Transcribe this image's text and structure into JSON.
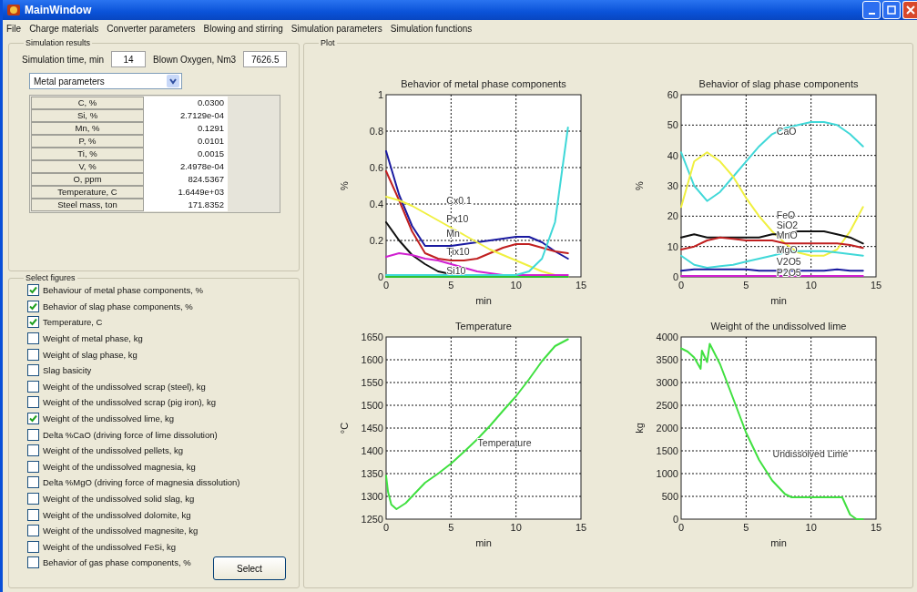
{
  "window": {
    "title": "MainWindow"
  },
  "menu": [
    "File",
    "Charge materials",
    "Converter parameters",
    "Blowing and stirring",
    "Simulation parameters",
    "Simulation functions"
  ],
  "simulation_results": {
    "title": "Simulation results",
    "time_label": "Simulation time, min",
    "time_value": "14",
    "oxygen_label": "Blown Oxygen, Nm3",
    "oxygen_value": "7626.5",
    "dropdown": "Metal parameters",
    "table": [
      {
        "label": "C, %",
        "value": "0.0300"
      },
      {
        "label": "Si, %",
        "value": "2.7129e-04"
      },
      {
        "label": "Mn, %",
        "value": "0.1291"
      },
      {
        "label": "P, %",
        "value": "0.0101"
      },
      {
        "label": "Ti, %",
        "value": "0.0015"
      },
      {
        "label": "V, %",
        "value": "2.4978e-04"
      },
      {
        "label": "O, ppm",
        "value": "824.5367"
      },
      {
        "label": "Temperature, C",
        "value": "1.6449e+03"
      },
      {
        "label": "Steel mass, ton",
        "value": "171.8352"
      }
    ]
  },
  "select_figures": {
    "title": "Select figures",
    "button": "Select",
    "items": [
      {
        "label": "Behaviour of metal phase components, %",
        "checked": true
      },
      {
        "label": "Behavior of slag phase components, %",
        "checked": true
      },
      {
        "label": "Temperature, C",
        "checked": true
      },
      {
        "label": "Weight of metal phase, kg",
        "checked": false
      },
      {
        "label": "Weight of slag phase, kg",
        "checked": false
      },
      {
        "label": "Slag basicity",
        "checked": false
      },
      {
        "label": "Weight of the undissolved scrap (steel), kg",
        "checked": false
      },
      {
        "label": "Weight of the undissolved scrap (pig iron), kg",
        "checked": false
      },
      {
        "label": "Weight of the undissolved lime, kg",
        "checked": true
      },
      {
        "label": "Delta %CaO (driving force of lime dissolution)",
        "checked": false
      },
      {
        "label": "Weight of the undissolved pellets, kg",
        "checked": false
      },
      {
        "label": "Weight of the undissolved magnesia, kg",
        "checked": false
      },
      {
        "label": "Delta %MgO (driving force of magnesia dissolution)",
        "checked": false
      },
      {
        "label": "Weight of the undissolved solid slag, kg",
        "checked": false
      },
      {
        "label": "Weight of the undissolved dolomite, kg",
        "checked": false
      },
      {
        "label": "Weight of the undissolved magnesite, kg",
        "checked": false
      },
      {
        "label": "Weight of the undissolved FeSi, kg",
        "checked": false
      },
      {
        "label": "Behavior of gas phase components, %",
        "checked": false
      }
    ]
  },
  "plot": {
    "title": "Plot",
    "charts": [
      {
        "chart_data": {
          "type": "line",
          "title": "Behavior of metal phase components",
          "xlabel": "min",
          "ylabel": "%",
          "xlim": [
            0,
            15
          ],
          "ylim": [
            0,
            1
          ],
          "xticks": [
            0,
            5,
            10,
            15
          ],
          "yticks": [
            0,
            0.2,
            0.4,
            0.6,
            0.8,
            1
          ],
          "x": [
            0,
            1,
            2,
            3,
            4,
            5,
            6,
            7,
            8,
            9,
            10,
            11,
            12,
            13,
            14
          ],
          "series": [
            {
              "color": "#1a1aa0",
              "values": [
                0.69,
                0.45,
                0.28,
                0.17,
                0.17,
                0.17,
                0.18,
                0.19,
                0.2,
                0.21,
                0.22,
                0.22,
                0.19,
                0.14,
                0.1
              ]
            },
            {
              "color": "#c02020",
              "values": [
                0.58,
                0.42,
                0.25,
                0.13,
                0.1,
                0.09,
                0.09,
                0.1,
                0.13,
                0.16,
                0.18,
                0.18,
                0.16,
                0.14,
                0.13
              ]
            },
            {
              "color": "#f0f040",
              "values": [
                0.44,
                0.42,
                0.39,
                0.35,
                0.31,
                0.27,
                0.23,
                0.19,
                0.15,
                0.12,
                0.09,
                0.06,
                0.03,
                0.01,
                0
              ]
            },
            {
              "color": "#101010",
              "values": [
                0.3,
                0.2,
                0.12,
                0.07,
                0.03,
                0.015,
                null,
                null,
                null,
                null,
                null,
                null,
                null,
                null,
                null
              ]
            },
            {
              "color": "#d020d0",
              "values": [
                0.11,
                0.13,
                0.12,
                0.1,
                0.09,
                0.07,
                0.05,
                0.03,
                0.02,
                0.01,
                0.01,
                0.01,
                0.01,
                0.01,
                0.01
              ]
            },
            {
              "color": "#40d8d8",
              "values": [
                0.01,
                0.01,
                0.01,
                0.01,
                0.01,
                0.01,
                0.01,
                0.01,
                0.01,
                0.01,
                0.01,
                0.03,
                0.1,
                0.3,
                0.82
              ]
            },
            {
              "color": "#30c030",
              "values": [
                0,
                0,
                0,
                0,
                0,
                0,
                0,
                0,
                0,
                0,
                0,
                0,
                0,
                0,
                0
              ]
            }
          ],
          "grid": true,
          "annotations": [
            "Cx0.1",
            "Px10",
            "Mn",
            "Tix10",
            "Si10"
          ]
        }
      },
      {
        "chart_data": {
          "type": "line",
          "title": "Behavior of slag phase components",
          "xlabel": "min",
          "ylabel": "%",
          "xlim": [
            0,
            15
          ],
          "ylim": [
            0,
            60
          ],
          "xticks": [
            0,
            5,
            10,
            15
          ],
          "yticks": [
            0,
            10,
            20,
            30,
            40,
            50,
            60
          ],
          "x": [
            0,
            1,
            2,
            3,
            4,
            5,
            6,
            7,
            8,
            9,
            10,
            11,
            12,
            13,
            14
          ],
          "series": [
            {
              "color": "#40d8d8",
              "values": [
                41,
                30,
                25,
                28,
                33,
                38,
                43,
                47,
                49,
                50,
                51,
                51,
                50,
                47,
                43
              ]
            },
            {
              "color": "#f0f040",
              "values": [
                23,
                38,
                41,
                38,
                33,
                26,
                20,
                15,
                11,
                8,
                7,
                7,
                9,
                15,
                23
              ]
            },
            {
              "color": "#101010",
              "values": [
                13,
                14,
                13,
                13,
                13,
                13,
                13,
                14,
                14,
                15,
                15,
                15,
                14,
                13,
                11
              ]
            },
            {
              "color": "#c02020",
              "values": [
                9,
                10,
                12,
                13,
                12.5,
                12,
                12,
                12,
                11,
                11,
                11,
                11,
                11,
                10.5,
                9.5
              ]
            },
            {
              "color": "#40d8d8",
              "values": [
                7,
                4,
                3,
                3.5,
                4,
                5,
                6,
                7,
                8,
                8.5,
                8.5,
                8.5,
                8,
                7.5,
                7
              ]
            },
            {
              "color": "#1a1aa0",
              "values": [
                2,
                2.5,
                2.5,
                2.5,
                2.5,
                2.5,
                2,
                2,
                2,
                2,
                2,
                2,
                2.5,
                2,
                2
              ]
            },
            {
              "color": "#d020d0",
              "values": [
                0.3,
                0.3,
                0.3,
                0.3,
                0.3,
                0.3,
                0.3,
                0.3,
                0.3,
                0.3,
                0.3,
                0.3,
                0.3,
                0.3,
                0.3
              ]
            }
          ],
          "grid": true,
          "annotations": [
            "CaO",
            "FeO",
            "SiO2",
            "MnO",
            "MgO",
            "V2O5",
            "P2O5"
          ]
        }
      },
      {
        "chart_data": {
          "type": "line",
          "title": "Temperature",
          "xlabel": "min",
          "ylabel": "°C",
          "xlim": [
            0,
            15
          ],
          "ylim": [
            1250,
            1650
          ],
          "xticks": [
            0,
            5,
            10,
            15
          ],
          "yticks": [
            1250,
            1300,
            1350,
            1400,
            1450,
            1500,
            1550,
            1600,
            1650
          ],
          "x": [
            0,
            0.15,
            0.4,
            0.8,
            1.5,
            2,
            3,
            4,
            5,
            6,
            7,
            8,
            9,
            10,
            11,
            12,
            13,
            14
          ],
          "series": [
            {
              "color": "#40e040",
              "values": [
                1345,
                1310,
                1282,
                1272,
                1285,
                1300,
                1330,
                1350,
                1372,
                1398,
                1425,
                1455,
                1488,
                1520,
                1557,
                1597,
                1630,
                1645
              ]
            }
          ],
          "grid": true,
          "annotations": [
            "Temperature"
          ]
        }
      },
      {
        "chart_data": {
          "type": "line",
          "title": "Weight of the undissolved lime",
          "xlabel": "min",
          "ylabel": "kg",
          "xlim": [
            0,
            15
          ],
          "ylim": [
            0,
            4000
          ],
          "xticks": [
            0,
            5,
            10,
            15
          ],
          "yticks": [
            0,
            500,
            1000,
            1500,
            2000,
            2500,
            3000,
            3500,
            4000
          ],
          "x": [
            0,
            0.5,
            1,
            1.5,
            1.6,
            2,
            2.2,
            3,
            4,
            5,
            6,
            7,
            8,
            8.5,
            10,
            12,
            12.4,
            13,
            13.5,
            14
          ],
          "series": [
            {
              "color": "#40e040",
              "values": [
                3750,
                3680,
                3550,
                3300,
                3700,
                3450,
                3850,
                3400,
                2650,
                1900,
                1300,
                850,
                550,
                480,
                480,
                480,
                480,
                100,
                0,
                0
              ]
            }
          ],
          "grid": true,
          "annotations": [
            "Undissolved Lime"
          ]
        }
      }
    ]
  }
}
